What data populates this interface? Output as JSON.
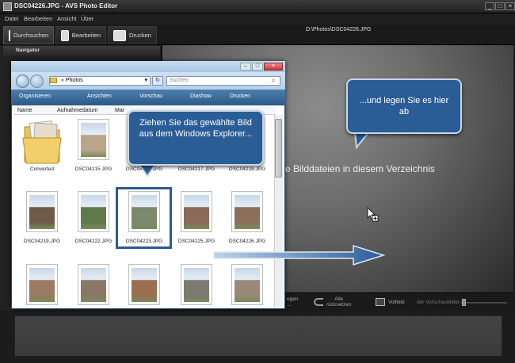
{
  "app": {
    "window_title": "DSC04226.JPG - AVS Photo Editor",
    "menu": [
      "Datei",
      "Bearbeiten",
      "Ansicht",
      "Über"
    ],
    "tabs": [
      {
        "label": "Durchsuchen",
        "icon": "browse-icon"
      },
      {
        "label": "Bearbeiten",
        "icon": "edit-icon"
      },
      {
        "label": "Drucken",
        "icon": "printer-icon"
      }
    ],
    "current_path": "D:\\Photos\\DSC04226.JPG",
    "navigator_label": "Navigator",
    "empty_message": "e Bilddateien in diesem Verzeichnis",
    "bottom": {
      "reset_top": "Alle",
      "reset_bottom": "rücksetzen",
      "left_clip_top": "egen",
      "left_clip_bottom": "...",
      "fullscreen": "Vollbild",
      "preview_label": "der Vorschaubilder:"
    }
  },
  "explorer": {
    "address": "Photos",
    "address_prefix": "«",
    "search_placeholder": "Suchen",
    "toolbar": [
      "Organisieren",
      "Ansichten",
      "Vorschau",
      "Diashow",
      "Drucken"
    ],
    "columns": [
      "Name",
      "Aufnahmedatum",
      "Mar"
    ],
    "files": [
      {
        "name": "Converted",
        "type": "folder"
      },
      {
        "name": "DSC04215.JPG",
        "type": "photo",
        "color": "#b9a58a"
      },
      {
        "name": "DSC04216.JPG",
        "type": "photo",
        "color": "#a89a80"
      },
      {
        "name": "DSC04217.JPG",
        "type": "photo",
        "color": "#9a8470"
      },
      {
        "name": "DSC04218.JPG",
        "type": "photo",
        "color": "#8a7560"
      },
      {
        "name": "DSC04219.JPG",
        "type": "photo",
        "color": "#6e5a48"
      },
      {
        "name": "DSC04222.JPG",
        "type": "photo",
        "color": "#5f7a4a"
      },
      {
        "name": "DSC04223.JPG",
        "type": "photo",
        "color": "#7a8a6a"
      },
      {
        "name": "DSC04225.JPG",
        "type": "photo",
        "color": "#8a6a58"
      },
      {
        "name": "DSC04226.JPG",
        "type": "photo",
        "color": "#8c6f5a"
      },
      {
        "name": "",
        "type": "photo",
        "color": "#9a7a60"
      },
      {
        "name": "",
        "type": "photo",
        "color": "#8a7866"
      },
      {
        "name": "",
        "type": "photo",
        "color": "#9a6e50"
      },
      {
        "name": "",
        "type": "photo",
        "color": "#7a7a70"
      },
      {
        "name": "",
        "type": "photo",
        "color": "#9a8878"
      }
    ]
  },
  "callouts": {
    "drag": "Ziehen Sie das gewählte Bild aus dem Windows Explorer...",
    "drop": "...und legen Sie es hier ab"
  }
}
